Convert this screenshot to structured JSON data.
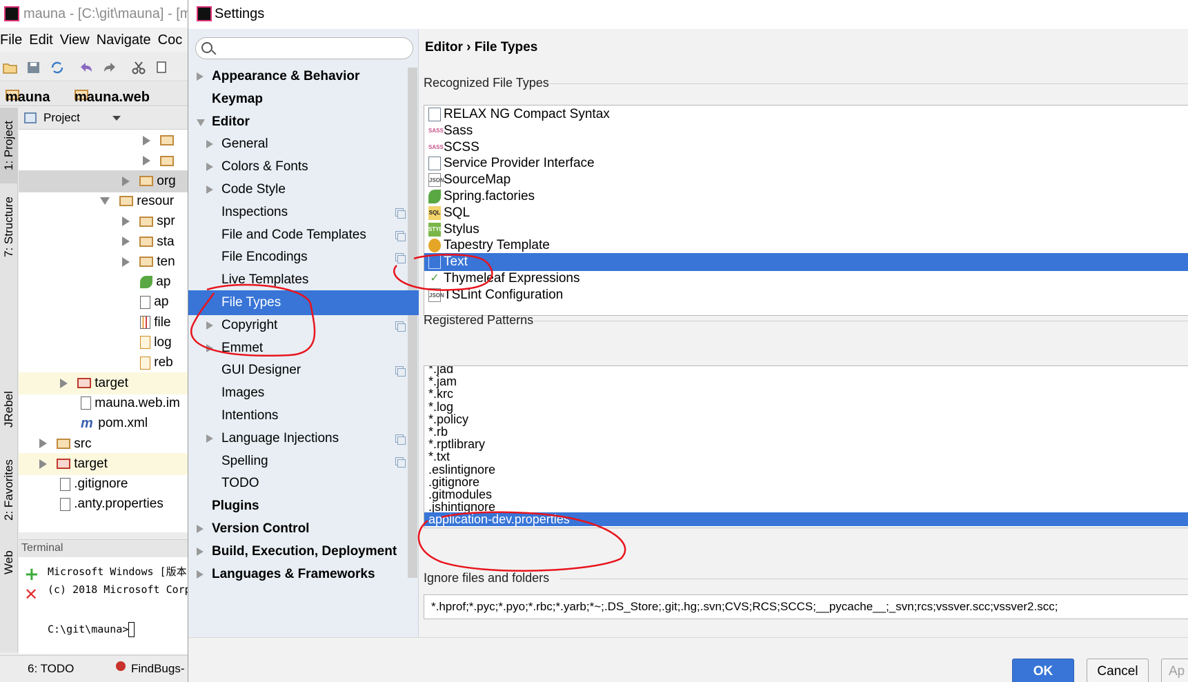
{
  "ide": {
    "title": "mauna - [C:\\git\\mauna] - [m",
    "menu": [
      "File",
      "Edit",
      "View",
      "Navigate",
      "Coc"
    ],
    "breadcrumb": [
      "mauna",
      "mauna.web"
    ],
    "project_label": "Project",
    "side_tabs": [
      "1: Project",
      "7: Structure",
      "JRebel",
      "2: Favorites",
      "Web"
    ],
    "tree": [
      {
        "label": "",
        "indent": 180,
        "arrow": "right",
        "icon": "folder"
      },
      {
        "label": "",
        "indent": 180,
        "arrow": "right",
        "icon": "folder"
      },
      {
        "label": "org",
        "indent": 150,
        "arrow": "right",
        "icon": "folder",
        "highlight": true
      },
      {
        "label": "resour",
        "indent": 118,
        "arrow": "down",
        "icon": "folder"
      },
      {
        "label": "spr",
        "indent": 150,
        "arrow": "right",
        "icon": "folder"
      },
      {
        "label": "sta",
        "indent": 150,
        "arrow": "right",
        "icon": "folder"
      },
      {
        "label": "ten",
        "indent": 150,
        "arrow": "right",
        "icon": "folder"
      },
      {
        "label": "ap",
        "indent": 176,
        "arrow": "none",
        "icon": "spring"
      },
      {
        "label": "ap",
        "indent": 176,
        "arrow": "none",
        "icon": "file"
      },
      {
        "label": "file",
        "indent": 176,
        "arrow": "none",
        "icon": "chart"
      },
      {
        "label": "log",
        "indent": 176,
        "arrow": "none",
        "icon": "xml"
      },
      {
        "label": "reb",
        "indent": 176,
        "arrow": "none",
        "icon": "xml"
      },
      {
        "label": "target",
        "indent": 60,
        "arrow": "right",
        "icon": "redfolder",
        "yellow": true
      },
      {
        "label": "mauna.web.im",
        "indent": 90,
        "arrow": "none",
        "icon": "file"
      },
      {
        "label": "pom.xml",
        "indent": 90,
        "arrow": "none",
        "icon": "maven"
      },
      {
        "label": "src",
        "indent": 30,
        "arrow": "right",
        "icon": "folder"
      },
      {
        "label": "target",
        "indent": 30,
        "arrow": "right",
        "icon": "redfolder",
        "yellow": true
      },
      {
        "label": ".gitignore",
        "indent": 60,
        "arrow": "none",
        "icon": "file"
      },
      {
        "label": ".anty.properties",
        "indent": 60,
        "arrow": "none",
        "icon": "file"
      }
    ],
    "terminal_label": "Terminal",
    "terminal_lines": [
      "Microsoft Windows [版本",
      "(c) 2018 Microsoft Corp",
      "",
      "C:\\git\\mauna>"
    ],
    "status": {
      "todo": "6: TODO",
      "findbugs": "FindBugs-"
    }
  },
  "dialog": {
    "title": "Settings",
    "search_placeholder": "",
    "nav": [
      {
        "label": "Appearance & Behavior",
        "bold": true,
        "level": 0,
        "arrow": "right"
      },
      {
        "label": "Keymap",
        "bold": true,
        "level": 0,
        "arrow": "none"
      },
      {
        "label": "Editor",
        "bold": true,
        "level": 0,
        "arrow": "down"
      },
      {
        "label": "General",
        "bold": false,
        "level": 1,
        "arrow": "right"
      },
      {
        "label": "Colors & Fonts",
        "bold": false,
        "level": 1,
        "arrow": "right"
      },
      {
        "label": "Code Style",
        "bold": false,
        "level": 1,
        "arrow": "right"
      },
      {
        "label": "Inspections",
        "bold": false,
        "level": 1,
        "arrow": "none",
        "copy": true
      },
      {
        "label": "File and Code Templates",
        "bold": false,
        "level": 1,
        "arrow": "none",
        "copy": true
      },
      {
        "label": "File Encodings",
        "bold": false,
        "level": 1,
        "arrow": "none",
        "copy": true
      },
      {
        "label": "Live Templates",
        "bold": false,
        "level": 1,
        "arrow": "none"
      },
      {
        "label": "File Types",
        "bold": false,
        "level": 1,
        "arrow": "none",
        "selected": true
      },
      {
        "label": "Copyright",
        "bold": false,
        "level": 1,
        "arrow": "right",
        "copy": true
      },
      {
        "label": "Emmet",
        "bold": false,
        "level": 1,
        "arrow": "right"
      },
      {
        "label": "GUI Designer",
        "bold": false,
        "level": 1,
        "arrow": "none",
        "copy": true
      },
      {
        "label": "Images",
        "bold": false,
        "level": 1,
        "arrow": "none"
      },
      {
        "label": "Intentions",
        "bold": false,
        "level": 1,
        "arrow": "none"
      },
      {
        "label": "Language Injections",
        "bold": false,
        "level": 1,
        "arrow": "right",
        "copy": true
      },
      {
        "label": "Spelling",
        "bold": false,
        "level": 1,
        "arrow": "none",
        "copy": true
      },
      {
        "label": "TODO",
        "bold": false,
        "level": 1,
        "arrow": "none"
      },
      {
        "label": "Plugins",
        "bold": true,
        "level": 0,
        "arrow": "none"
      },
      {
        "label": "Version Control",
        "bold": true,
        "level": 0,
        "arrow": "right"
      },
      {
        "label": "Build, Execution, Deployment",
        "bold": true,
        "level": 0,
        "arrow": "right"
      },
      {
        "label": "Languages & Frameworks",
        "bold": true,
        "level": 0,
        "arrow": "right"
      }
    ],
    "breadcrumb": "Editor › File Types",
    "recognized_title": "Recognized File Types",
    "file_types": [
      {
        "label": "RELAX NG Compact Syntax",
        "icon": "doc"
      },
      {
        "label": "Sass",
        "icon": "sass"
      },
      {
        "label": "SCSS",
        "icon": "sass"
      },
      {
        "label": "Service Provider Interface",
        "icon": "doc"
      },
      {
        "label": "SourceMap",
        "icon": "json"
      },
      {
        "label": "Spring.factories",
        "icon": "spring"
      },
      {
        "label": "SQL",
        "icon": "sql"
      },
      {
        "label": "Stylus",
        "icon": "styl"
      },
      {
        "label": "Tapestry Template",
        "icon": "tapestry"
      },
      {
        "label": "Text",
        "icon": "doc",
        "selected": true
      },
      {
        "label": "Thymeleaf Expressions",
        "icon": "thyme"
      },
      {
        "label": "TSLint Configuration",
        "icon": "json"
      }
    ],
    "patterns_title": "Registered Patterns",
    "patterns": [
      "*.jad",
      "*.jam",
      "*.krc",
      "*.log",
      "*.policy",
      "*.rb",
      "*.rptlibrary",
      "*.txt",
      ".eslintignore",
      ".gitignore",
      ".gitmodules",
      ".jshintignore",
      "application-dev.properties"
    ],
    "selected_pattern": "application-dev.properties",
    "ignore_title": "Ignore files and folders",
    "ignore_value": "*.hprof;*.pyc;*.pyo;*.rbc;*.yarb;*~;.DS_Store;.git;.hg;.svn;CVS;RCS;SCCS;__pycache__;_svn;rcs;vssver.scc;vssver2.scc;",
    "buttons": {
      "ok": "OK",
      "cancel": "Cancel",
      "apply": "Ap"
    }
  },
  "colors": {
    "selection": "#3875d7",
    "annotation": "#e8141c",
    "nav_bg": "#e8eef4"
  }
}
